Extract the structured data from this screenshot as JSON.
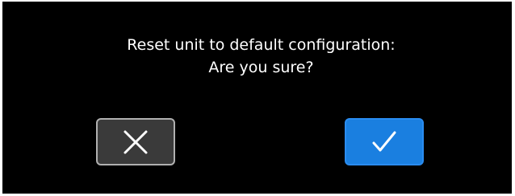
{
  "dialog": {
    "message_line1": "Reset unit to default configuration:",
    "message_line2": "Are you sure?",
    "cancel_button": {
      "icon": "close-icon",
      "color": "#3a3a3a"
    },
    "confirm_button": {
      "icon": "checkmark-icon",
      "color": "#1a7fe0"
    }
  }
}
